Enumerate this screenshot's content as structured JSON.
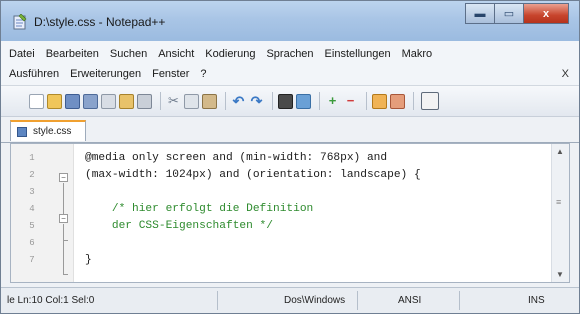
{
  "window": {
    "title": "D:\\style.css - Notepad++",
    "controls": {
      "minimize": "▬",
      "maximize": "▭",
      "close": "x"
    }
  },
  "menu": {
    "row1": [
      "Datei",
      "Bearbeiten",
      "Suchen",
      "Ansicht",
      "Kodierung",
      "Sprachen",
      "Einstellungen",
      "Makro"
    ],
    "row2": [
      "Ausführen",
      "Erweiterungen",
      "Fenster",
      "?"
    ],
    "close_label": "X"
  },
  "toolbar": {
    "icons": [
      "new-file",
      "open-file",
      "save",
      "save-all",
      "close",
      "close-all",
      "print",
      "cut",
      "copy",
      "paste",
      "undo",
      "redo",
      "find",
      "replace",
      "zoom-in",
      "zoom-out",
      "sync-vertical",
      "sync-horizontal",
      "word-wrap"
    ]
  },
  "tab": {
    "label": "style.css"
  },
  "editor": {
    "line_numbers": [
      "1",
      "2",
      "3",
      "4",
      "5",
      "6",
      "7"
    ],
    "lines": [
      {
        "text": "@media only screen and (min-width: 768px) and",
        "kind": "default"
      },
      {
        "text": "(max-width: 1024px) and (orientation: landscape) {",
        "kind": "default"
      },
      {
        "text": "",
        "kind": "default"
      },
      {
        "text": "    /* hier erfolgt die Definition",
        "kind": "comment"
      },
      {
        "text": "    der CSS-Eigenschaften */",
        "kind": "comment"
      },
      {
        "text": "",
        "kind": "default"
      },
      {
        "text": "}",
        "kind": "default"
      }
    ],
    "colors": {
      "default": "#1b1b1b",
      "comment": "#2e8b2e"
    }
  },
  "statusbar": {
    "position": "le Ln:10   Col:1   Sel:0",
    "eol": "Dos\\Windows",
    "encoding": "ANSI",
    "mode": "INS"
  }
}
